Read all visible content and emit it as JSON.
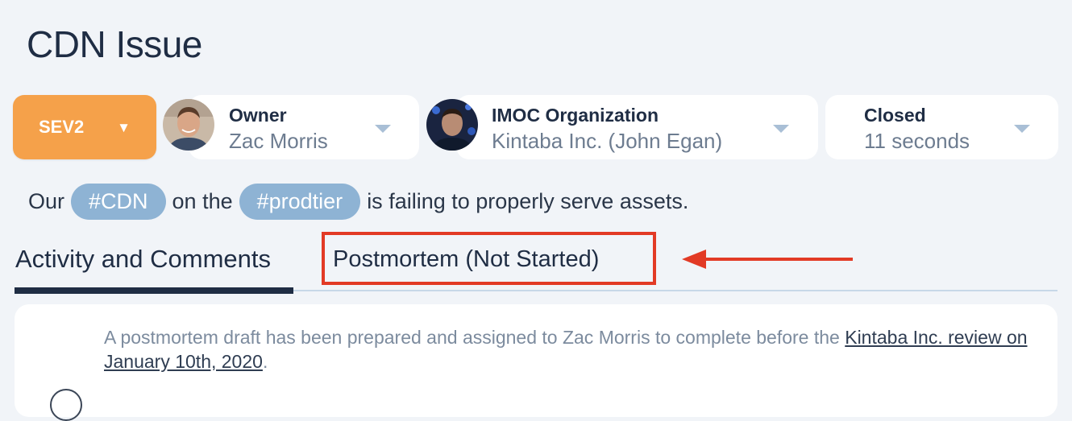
{
  "incident": {
    "title": "CDN Issue",
    "severity": {
      "label": "SEV2",
      "caret": "▼",
      "color": "#f5a14a"
    }
  },
  "fields": {
    "owner": {
      "label": "Owner",
      "value": "Zac Morris"
    },
    "imoc": {
      "label": "IMOC Organization",
      "value": "Kintaba Inc. (John Egan)"
    },
    "status": {
      "label": "Closed",
      "value": "11 seconds"
    }
  },
  "description": {
    "prefix": "Our",
    "tag1": "#CDN",
    "middle": "on the",
    "tag2": "#prodtier",
    "suffix": "is failing to properly serve assets."
  },
  "tabs": [
    {
      "label": "Activity and Comments",
      "active": true
    },
    {
      "label": "Postmortem (Not Started)",
      "active": false,
      "highlighted": true
    }
  ],
  "activity": {
    "text": "A postmortem draft has been prepared and assigned to Zac Morris to complete before the ",
    "link": "Kintaba Inc. review on January 10th, 2020",
    "end": "."
  },
  "colors": {
    "primary": "#1f2d44",
    "tag": "#8eb3d4",
    "annotation": "#e23a25",
    "background": "#f1f4f8"
  }
}
